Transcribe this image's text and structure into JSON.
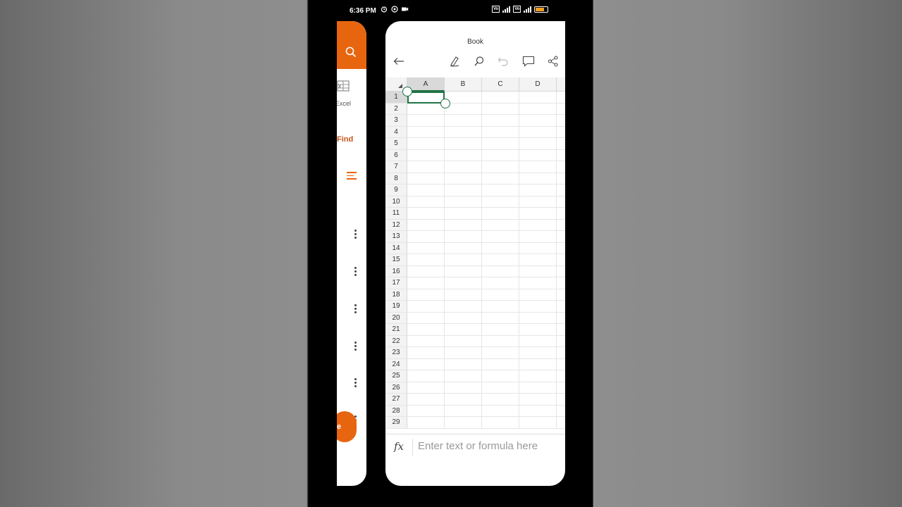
{
  "status_bar": {
    "time": "6:36 PM"
  },
  "file_app": {
    "excel_label": "Excel",
    "find_label": "Find",
    "fab_label": "e"
  },
  "workbook": {
    "title": "Book",
    "columns": [
      "A",
      "B",
      "C",
      "D"
    ],
    "rows": [
      "1",
      "2",
      "3",
      "4",
      "5",
      "6",
      "7",
      "8",
      "9",
      "10",
      "11",
      "12",
      "13",
      "14",
      "15",
      "16",
      "17",
      "18",
      "19",
      "20",
      "21",
      "22",
      "23",
      "24",
      "25",
      "26",
      "27",
      "28",
      "29"
    ],
    "selected_cell": "A1",
    "formula_placeholder": "Enter text or formula here",
    "formula_symbol": "fx"
  }
}
